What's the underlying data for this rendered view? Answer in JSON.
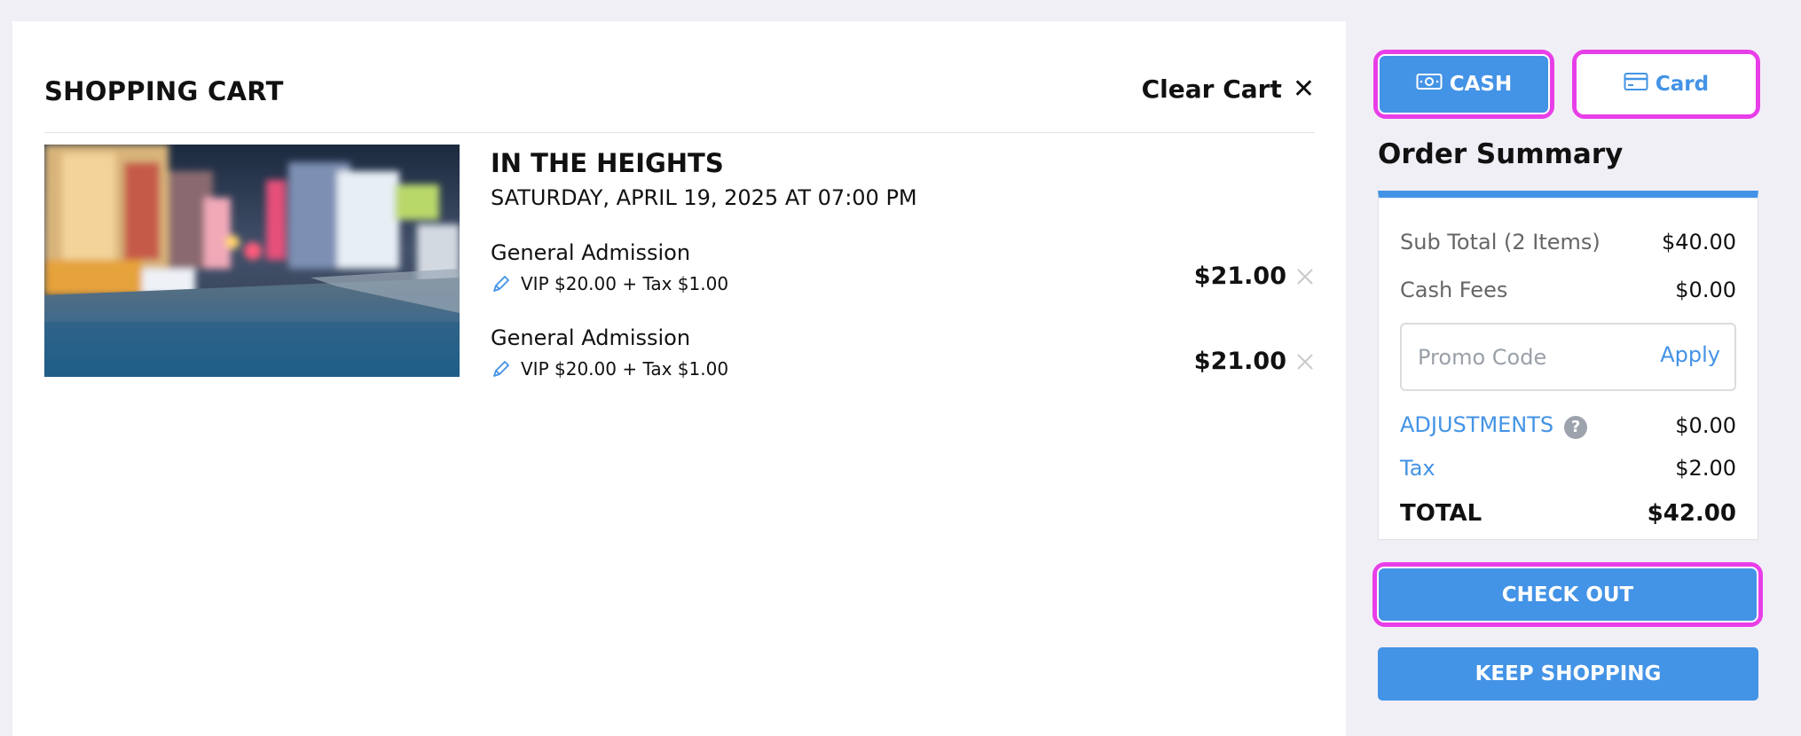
{
  "cart": {
    "title": "SHOPPING CART",
    "clear_label": "Clear Cart",
    "clear_icon": "✕"
  },
  "event": {
    "name": "IN THE HEIGHTS",
    "date": "SATURDAY, APRIL 19, 2025 AT 07:00 PM",
    "image": "city-street-photo"
  },
  "tickets": [
    {
      "type": "General Admission",
      "detail": "VIP $20.00 + Tax $1.00",
      "price": "$21.00"
    },
    {
      "type": "General Admission",
      "detail": "VIP $20.00 + Tax $1.00",
      "price": "$21.00"
    }
  ],
  "payment": {
    "cash_label": "CASH",
    "card_label": "Card"
  },
  "summary": {
    "title": "Order Summary",
    "subtotal_label": "Sub Total (2 Items)",
    "subtotal_value": "$40.00",
    "cash_fees_label": "Cash Fees",
    "cash_fees_value": "$0.00",
    "promo_placeholder": "Promo Code",
    "apply_label": "Apply",
    "adjustments_label": "ADJUSTMENTS",
    "adjustments_value": "$0.00",
    "tax_label": "Tax",
    "tax_value": "$2.00",
    "total_label": "TOTAL",
    "total_value": "$42.00"
  },
  "actions": {
    "checkout_label": "CHECK OUT",
    "keep_shopping_label": "KEEP SHOPPING"
  },
  "colors": {
    "accent": "#4393e6",
    "highlight": "#e83ee8"
  }
}
